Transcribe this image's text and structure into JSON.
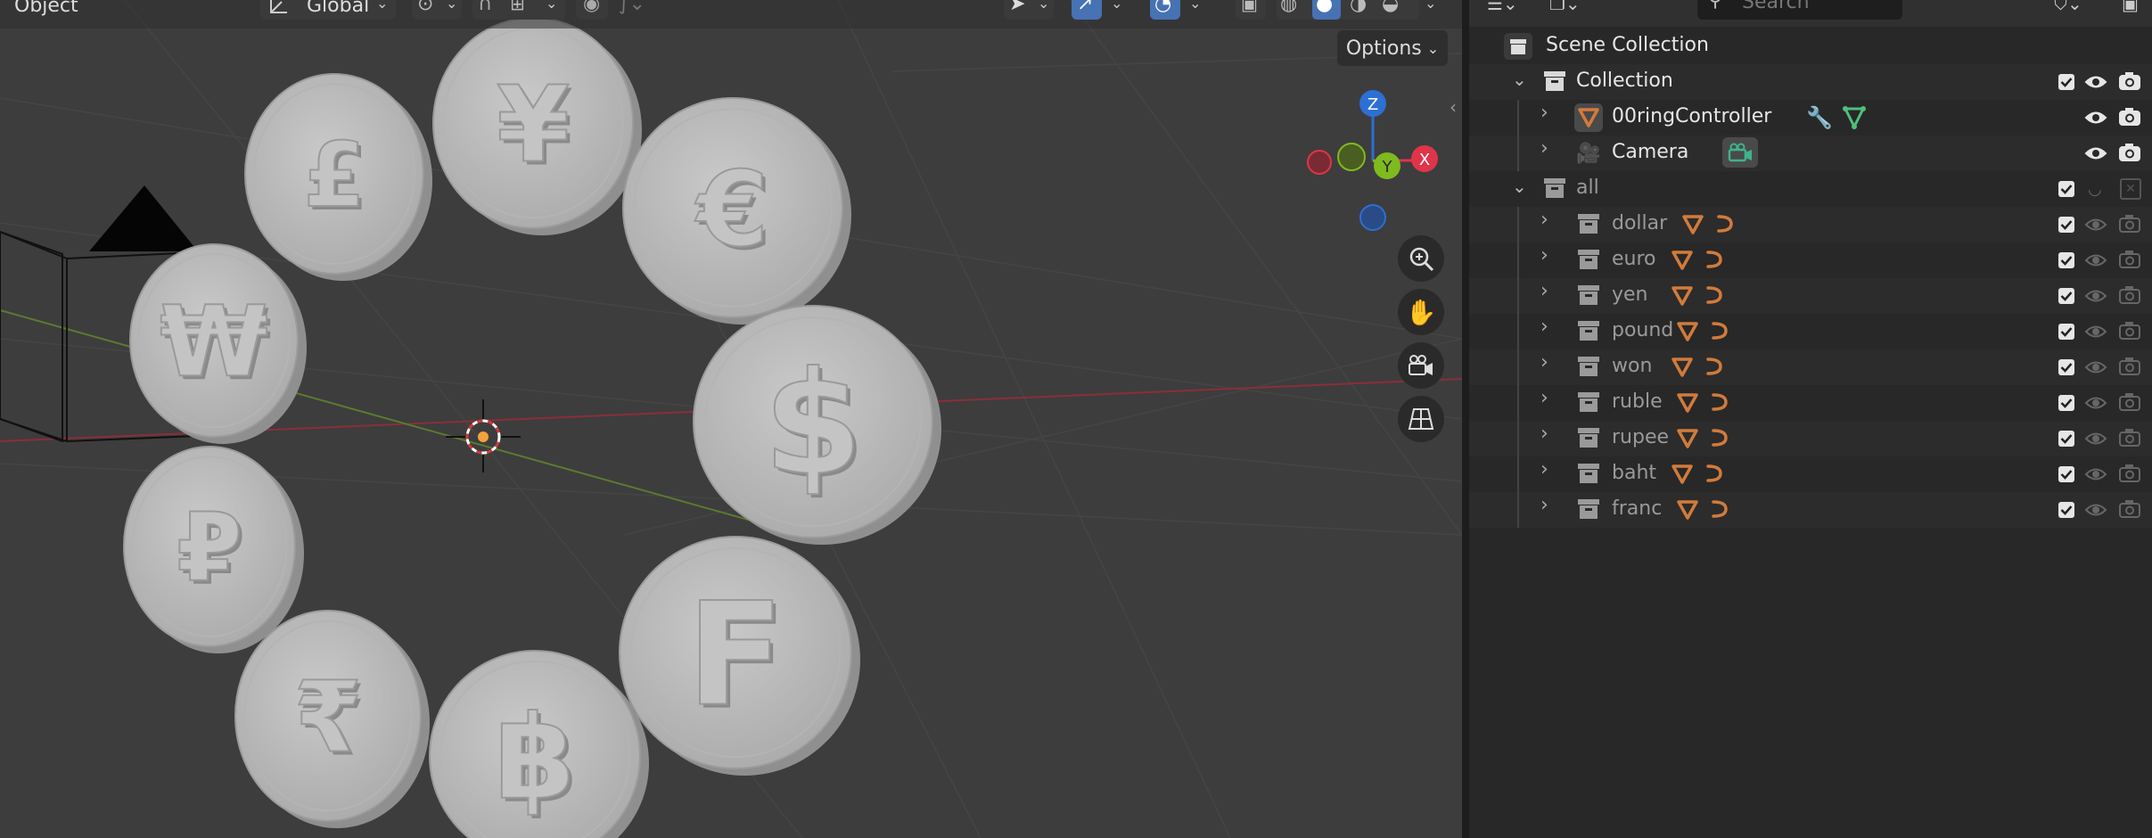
{
  "viewport": {
    "mode_label": "Object",
    "orientation_label": "Global",
    "options_label": "Options",
    "gizmo_axes": {
      "z": "Z",
      "x": "X",
      "y": "Y"
    },
    "coins": [
      {
        "symbol": "£"
      },
      {
        "symbol": "¥"
      },
      {
        "symbol": "€"
      },
      {
        "symbol": "₩"
      },
      {
        "symbol": "$"
      },
      {
        "symbol": "₽"
      },
      {
        "symbol": "F"
      },
      {
        "symbol": "₹"
      },
      {
        "symbol": "฿"
      }
    ],
    "nav_icons": [
      "zoom-icon",
      "hand-pan-icon",
      "camera-view-icon",
      "ortho-grid-icon"
    ]
  },
  "outliner": {
    "search_placeholder": "Search",
    "scene_collection": "Scene Collection",
    "rows": [
      {
        "label": "Collection",
        "kind": "collection"
      },
      {
        "label": "00ringController",
        "kind": "object"
      },
      {
        "label": "Camera",
        "kind": "camera"
      },
      {
        "label": "all",
        "kind": "collection"
      },
      {
        "label": "dollar",
        "kind": "child"
      },
      {
        "label": "euro",
        "kind": "child"
      },
      {
        "label": "yen",
        "kind": "child"
      },
      {
        "label": "pound",
        "kind": "child"
      },
      {
        "label": "won",
        "kind": "child"
      },
      {
        "label": "ruble",
        "kind": "child"
      },
      {
        "label": "rupee",
        "kind": "child"
      },
      {
        "label": "baht",
        "kind": "child"
      },
      {
        "label": "franc",
        "kind": "child"
      }
    ]
  },
  "colors": {
    "accent": "#4772b3",
    "x_axis": "#e0344a",
    "y_axis": "#7fba1f",
    "z_axis": "#2d6fd3",
    "modifier": "#5d8fd8",
    "mesh": "#d27b3b",
    "camera": "#3eb48a"
  }
}
